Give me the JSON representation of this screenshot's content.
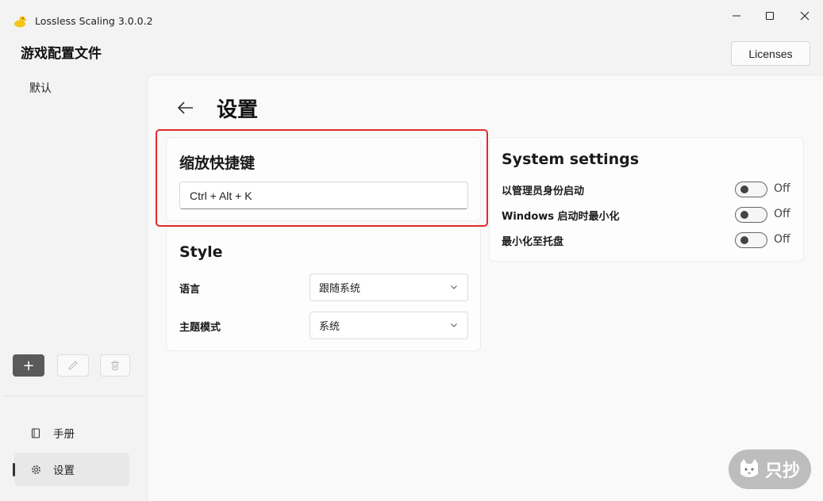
{
  "window": {
    "title": "Lossless Scaling 3.0.0.2",
    "minimize_glyph": "─",
    "maximize_glyph": "☐",
    "close_glyph": "✕"
  },
  "sidebar": {
    "profiles_title": "游戏配置文件",
    "profiles": [
      {
        "label": "默认"
      }
    ],
    "add_glyph": "+",
    "nav": [
      {
        "label": "手册",
        "icon": "book-icon"
      },
      {
        "label": "设置",
        "icon": "gear-icon",
        "selected": true
      }
    ]
  },
  "header": {
    "licenses_label": "Licenses"
  },
  "page": {
    "title": "设置"
  },
  "hotkey_card": {
    "title": "缩放快捷键",
    "value": "Ctrl + Alt + K"
  },
  "style_card": {
    "title": "Style",
    "language_label": "语言",
    "language_value": "跟随系统",
    "theme_label": "主题模式",
    "theme_value": "系统"
  },
  "system_card": {
    "title": "System settings",
    "settings": [
      {
        "label": "以管理员身份启动",
        "state": "Off"
      },
      {
        "label": "Windows 启动时最小化",
        "state": "Off"
      },
      {
        "label": "最小化至托盘",
        "state": "Off"
      }
    ]
  },
  "watermark": {
    "text": "只抄"
  },
  "colors": {
    "highlight_border": "#e42a2a",
    "add_button_bg": "#5a5a5a"
  }
}
